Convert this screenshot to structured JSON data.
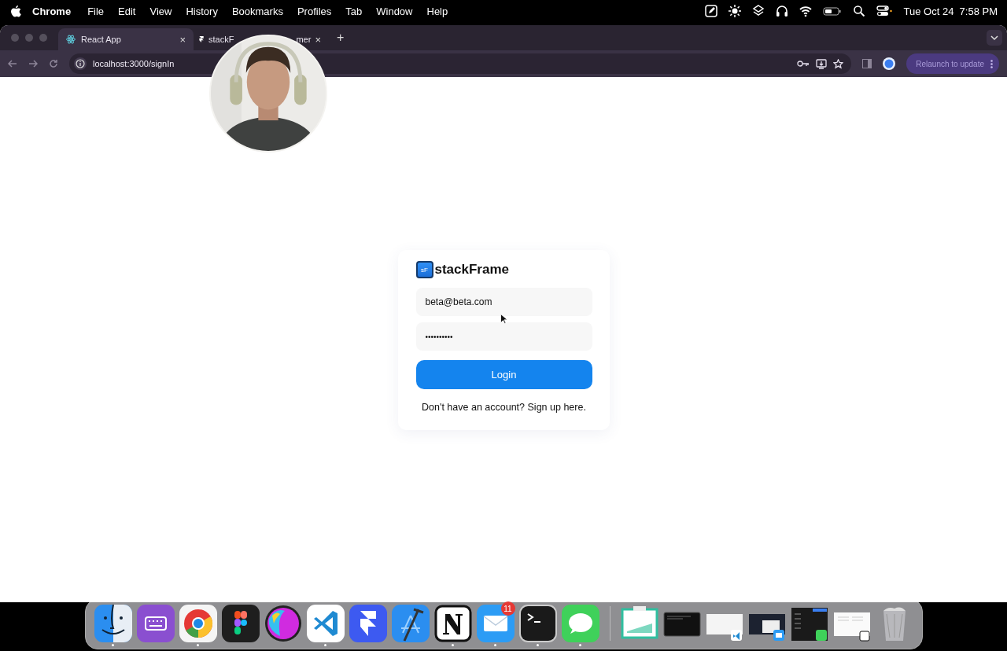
{
  "menu_bar": {
    "app": "Chrome",
    "menus": [
      "File",
      "Edit",
      "View",
      "History",
      "Bookmarks",
      "Profiles",
      "Tab",
      "Window",
      "Help"
    ],
    "clock": "Tue Oct 24  7:58 PM"
  },
  "browser": {
    "tabs": [
      {
        "title": "React App",
        "close": "×",
        "selected": true
      },
      {
        "title": "stackF",
        "title_end": "mer",
        "close": "×",
        "selected": false
      }
    ],
    "new_tab": "+",
    "address": "localhost:3000/signIn",
    "update_button": "Relaunch to update"
  },
  "login": {
    "brand_mark": "sF",
    "brand": "stackFrame",
    "email": {
      "value": "beta@beta.com"
    },
    "password": {
      "value": "••••••••••"
    },
    "submit": "Login",
    "signup_prompt": "Don't have an account? Sign up here."
  },
  "dock": {
    "items": [
      {
        "kind": "app",
        "running": true
      },
      {
        "kind": "app",
        "running": false
      },
      {
        "kind": "app",
        "running": true
      },
      {
        "kind": "app",
        "running": false
      },
      {
        "kind": "app",
        "running": false
      },
      {
        "kind": "app",
        "running": true
      },
      {
        "kind": "app",
        "running": false
      },
      {
        "kind": "app",
        "running": false
      },
      {
        "kind": "app",
        "running": true
      },
      {
        "kind": "app",
        "running": true,
        "badge": "11"
      },
      {
        "kind": "app",
        "running": true
      },
      {
        "kind": "app",
        "running": true
      },
      {
        "kind": "window",
        "running": false
      },
      {
        "kind": "window",
        "running": false
      },
      {
        "kind": "window",
        "running": false
      },
      {
        "kind": "window",
        "running": false
      },
      {
        "kind": "window",
        "running": false
      },
      {
        "kind": "window",
        "running": false
      },
      {
        "kind": "trash",
        "running": false
      }
    ]
  }
}
